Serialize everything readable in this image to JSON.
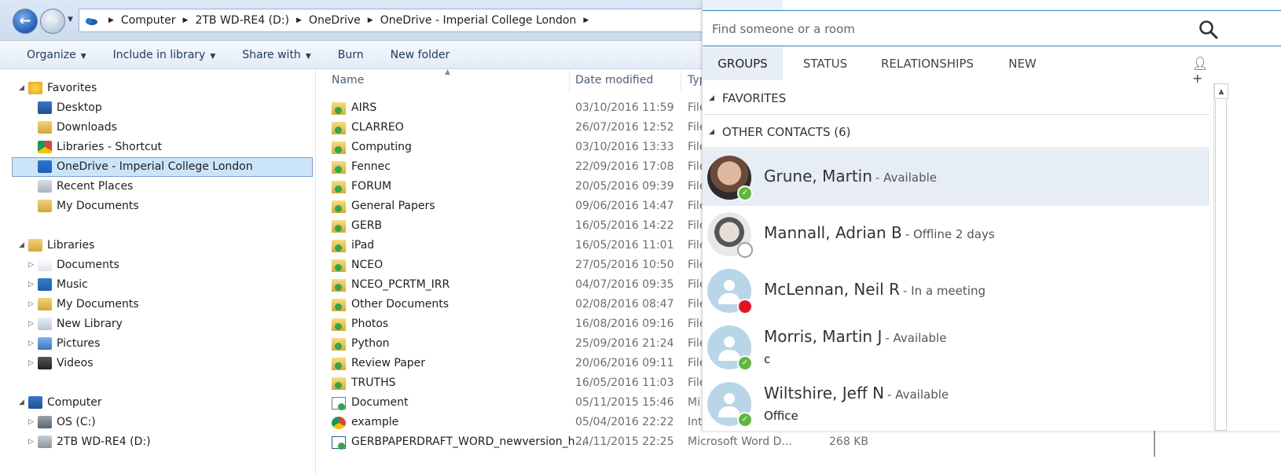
{
  "explorer": {
    "breadcrumbs": [
      "Computer",
      "2TB WD-RE4 (D:)",
      "OneDrive",
      "OneDrive - Imperial College London"
    ],
    "toolbar": [
      {
        "label": "Organize",
        "dropdown": true
      },
      {
        "label": "Include in library",
        "dropdown": true
      },
      {
        "label": "Share with",
        "dropdown": true
      },
      {
        "label": "Burn",
        "dropdown": false
      },
      {
        "label": "New folder",
        "dropdown": false
      }
    ],
    "nav": {
      "favorites": {
        "label": "Favorites",
        "items": [
          "Desktop",
          "Downloads",
          "Libraries - Shortcut",
          "OneDrive - Imperial College London",
          "Recent Places",
          "My Documents"
        ]
      },
      "libraries": {
        "label": "Libraries",
        "items": [
          "Documents",
          "Music",
          "My Documents",
          "New Library",
          "Pictures",
          "Videos"
        ]
      },
      "computer": {
        "label": "Computer",
        "items": [
          "OS (C:)",
          "2TB WD-RE4 (D:)"
        ]
      },
      "selected": "OneDrive - Imperial College London"
    },
    "columns": {
      "name": "Name",
      "date": "Date modified",
      "type": "Typ"
    },
    "files": [
      {
        "name": "AIRS",
        "date": "03/10/2016 11:59",
        "type": "File",
        "kind": "folder"
      },
      {
        "name": "CLARREO",
        "date": "26/07/2016 12:52",
        "type": "File",
        "kind": "folder"
      },
      {
        "name": "Computing",
        "date": "03/10/2016 13:33",
        "type": "File",
        "kind": "folder"
      },
      {
        "name": "Fennec",
        "date": "22/09/2016 17:08",
        "type": "File",
        "kind": "folder"
      },
      {
        "name": "FORUM",
        "date": "20/05/2016 09:39",
        "type": "File",
        "kind": "folder"
      },
      {
        "name": "General Papers",
        "date": "09/06/2016 14:47",
        "type": "File",
        "kind": "folder"
      },
      {
        "name": "GERB",
        "date": "16/05/2016 14:22",
        "type": "File",
        "kind": "folder"
      },
      {
        "name": "iPad",
        "date": "16/05/2016 11:01",
        "type": "File",
        "kind": "folder"
      },
      {
        "name": "NCEO",
        "date": "27/05/2016 10:50",
        "type": "File",
        "kind": "folder"
      },
      {
        "name": "NCEO_PCRTM_IRR",
        "date": "04/07/2016 09:35",
        "type": "File",
        "kind": "folder"
      },
      {
        "name": "Other Documents",
        "date": "02/08/2016 08:47",
        "type": "File",
        "kind": "folder"
      },
      {
        "name": "Photos",
        "date": "16/08/2016 09:16",
        "type": "File",
        "kind": "folder"
      },
      {
        "name": "Python",
        "date": "25/09/2016 21:24",
        "type": "File",
        "kind": "folder"
      },
      {
        "name": "Review Paper",
        "date": "20/06/2016 09:11",
        "type": "File",
        "kind": "folder"
      },
      {
        "name": "TRUTHS",
        "date": "16/05/2016 11:03",
        "type": "File",
        "kind": "folder"
      },
      {
        "name": "Document",
        "date": "05/11/2015 15:46",
        "type": "Mi",
        "kind": "doc"
      },
      {
        "name": "example",
        "date": "05/04/2016 22:22",
        "type": "Int",
        "kind": "chrome"
      },
      {
        "name": "GERBPAPERDRAFT_WORD_newversion_h...",
        "date": "24/11/2015 22:25",
        "type": "Microsoft Word D...",
        "size": "268 KB",
        "kind": "word"
      }
    ]
  },
  "skype": {
    "search_placeholder": "Find someone or a room",
    "tabs": [
      "GROUPS",
      "STATUS",
      "RELATIONSHIPS",
      "NEW"
    ],
    "active_tab": "GROUPS",
    "groups": [
      "FAVORITES",
      "OTHER CONTACTS (6)"
    ],
    "contacts": [
      {
        "name": "Grune, Martin",
        "status": "- Available",
        "note": "",
        "presence": "available",
        "avatar": "photo1",
        "highlighted": true
      },
      {
        "name": "Mannall, Adrian B",
        "status": "- Offline 2 days",
        "note": "",
        "presence": "offline",
        "avatar": "photo2",
        "highlighted": false
      },
      {
        "name": "McLennan, Neil R",
        "status": "- In a meeting",
        "note": "",
        "presence": "busy",
        "avatar": "placeholder",
        "highlighted": false
      },
      {
        "name": "Morris, Martin J",
        "status": "- Available",
        "note": "c",
        "presence": "available",
        "avatar": "placeholder",
        "highlighted": false
      },
      {
        "name": "Wiltshire, Jeff N",
        "status": "- Available",
        "note": "Office",
        "presence": "available",
        "avatar": "placeholder",
        "highlighted": false
      }
    ],
    "colors": {
      "accent": "#2f7fc1",
      "available": "#5fb83b",
      "busy": "#e81123",
      "highlight": "#e6edf4"
    }
  }
}
